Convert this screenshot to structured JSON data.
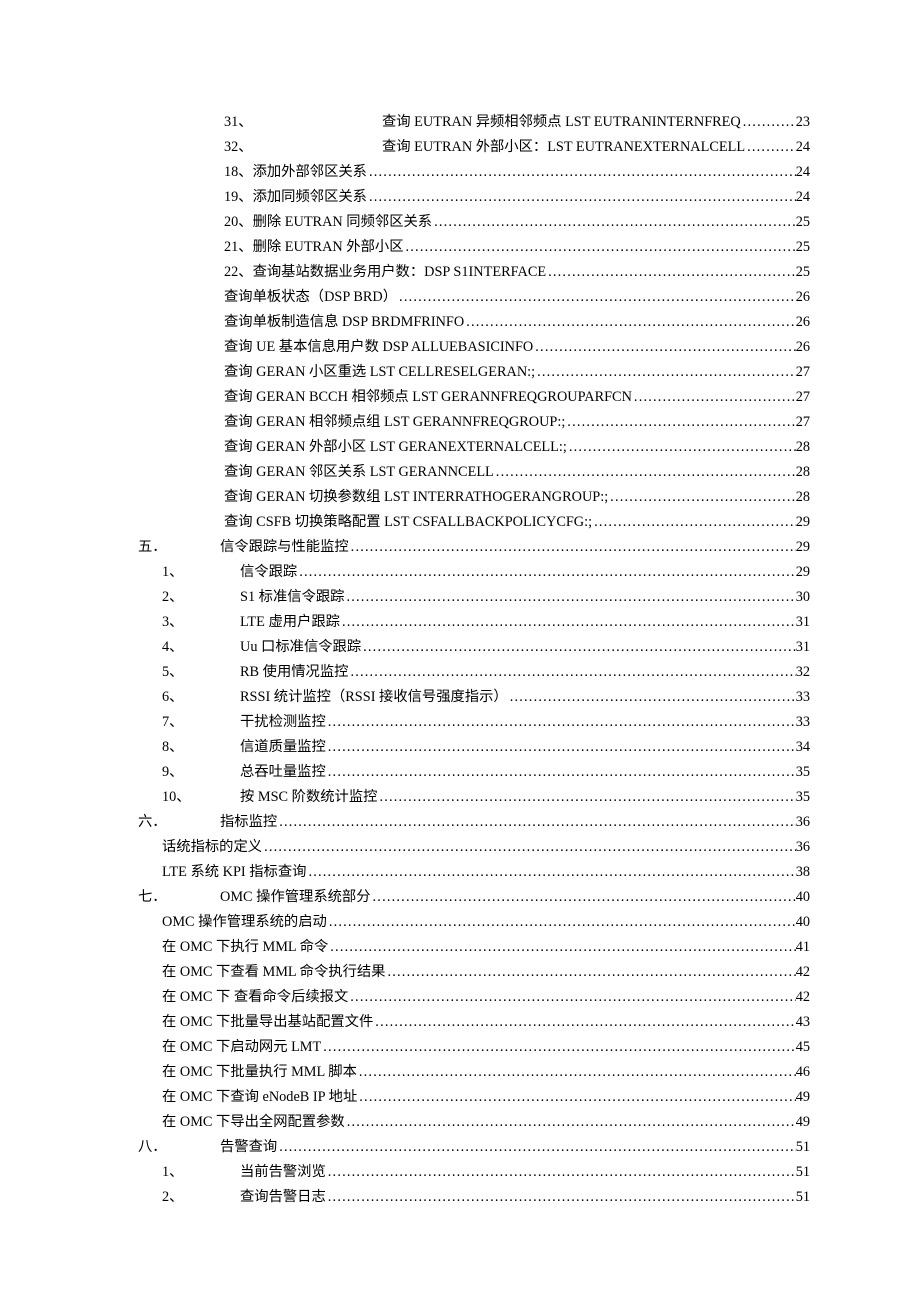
{
  "rows": [
    {
      "style": "deepnum",
      "num": "31、",
      "label": "查询 EUTRAN 异频相邻频点 LST EUTRANINTERNFREQ",
      "page": "23"
    },
    {
      "style": "deepnum",
      "num": "32、",
      "label": "查询 EUTRAN 外部小区：LST EUTRANEXTERNALCELL",
      "page": "24"
    },
    {
      "style": "deepplain",
      "num": "",
      "label": "18、添加外部邻区关系",
      "page": "24"
    },
    {
      "style": "deepplain",
      "num": "",
      "label": "19、添加同频邻区关系",
      "page": "24"
    },
    {
      "style": "deepplain",
      "num": "",
      "label": "20、删除 EUTRAN 同频邻区关系",
      "page": "25"
    },
    {
      "style": "deepplain",
      "num": "",
      "label": "21、删除 EUTRAN 外部小区",
      "page": "25"
    },
    {
      "style": "deepplain",
      "num": "",
      "label": "22、查询基站数据业务用户数：DSP S1INTERFACE",
      "page": "25"
    },
    {
      "style": "deepplain",
      "num": "",
      "label": "查询单板状态（DSP BRD）",
      "page": "26"
    },
    {
      "style": "deepplain",
      "num": "",
      "label": "查询单板制造信息 DSP BRDMFRINFO",
      "page": "26"
    },
    {
      "style": "deepplain",
      "num": "",
      "label": "查询 UE 基本信息用户数    DSP ALLUEBASICINFO",
      "page": "26"
    },
    {
      "style": "deepplain",
      "num": "",
      "label": "查询 GERAN 小区重选 LST CELLRESELGERAN:;",
      "page": "27"
    },
    {
      "style": "deepplain",
      "num": "",
      "label": "查询 GERAN BCCH 相邻频点  LST GERANNFREQGROUPARFCN",
      "page": "27"
    },
    {
      "style": "deepplain",
      "num": "",
      "label": "查询 GERAN 相邻频点组 LST GERANNFREQGROUP:;",
      "page": "27"
    },
    {
      "style": "deepplain",
      "num": "",
      "label": "查询 GERAN 外部小区 LST GERANEXTERNALCELL:;",
      "page": "28"
    },
    {
      "style": "deepplain",
      "num": "",
      "label": "查询 GERAN 邻区关系 LST GERANNCELL",
      "page": "28"
    },
    {
      "style": "deepplain",
      "num": "",
      "label": "查询 GERAN 切换参数组 LST INTERRATHOGERANGROUP:;",
      "page": "28"
    },
    {
      "style": "deepplain",
      "num": "",
      "label": "查询 CSFB 切换策略配置 LST CSFALLBACKPOLICYCFG:;",
      "page": "29"
    },
    {
      "style": "major",
      "majornum": "五．",
      "label": "信令跟踪与性能监控",
      "page": "29"
    },
    {
      "style": "itemnum",
      "num": "1、",
      "label": "信令跟踪",
      "page": "29"
    },
    {
      "style": "itemnum",
      "num": "2、",
      "label": "S1 标准信令跟踪",
      "page": "30"
    },
    {
      "style": "itemnum",
      "num": "3、",
      "label": "LTE 虚用户跟踪",
      "page": "31"
    },
    {
      "style": "itemnum",
      "num": "4、",
      "label": "Uu 口标准信令跟踪",
      "page": "31"
    },
    {
      "style": "itemnum",
      "num": "5、",
      "label": "RB 使用情况监控",
      "page": "32"
    },
    {
      "style": "itemnum",
      "num": "6、",
      "label": "RSSI 统计监控（RSSI  接收信号强度指示）",
      "page": "33"
    },
    {
      "style": "itemnum",
      "num": "7、",
      "label": "干扰检测监控",
      "page": "33"
    },
    {
      "style": "itemnum",
      "num": "8、",
      "label": "信道质量监控",
      "page": "34"
    },
    {
      "style": "itemnum",
      "num": "9、",
      "label": "总吞吐量监控",
      "page": "35"
    },
    {
      "style": "itemnum",
      "num": "10、",
      "label": "按 MSC 阶数统计监控",
      "page": "35"
    },
    {
      "style": "major",
      "majornum": "六．",
      "label": "指标监控",
      "page": "36"
    },
    {
      "style": "sub",
      "num": "",
      "label": "话统指标的定义",
      "page": "36"
    },
    {
      "style": "sub",
      "num": "",
      "label": "LTE 系统 KPI 指标查询",
      "page": "38"
    },
    {
      "style": "major",
      "majornum": "七．",
      "label": "OMC 操作管理系统部分",
      "page": "40"
    },
    {
      "style": "sub",
      "num": "",
      "label": "OMC 操作管理系统的启动",
      "page": "40"
    },
    {
      "style": "sub",
      "num": "",
      "label": "在 OMC 下执行 MML 命令",
      "page": "41"
    },
    {
      "style": "sub",
      "num": "",
      "label": "在 OMC 下查看 MML  命令执行结果",
      "page": "42"
    },
    {
      "style": "sub",
      "num": "",
      "label": "在 OMC 下 查看命令后续报文",
      "page": "42"
    },
    {
      "style": "sub",
      "num": "",
      "label": "在 OMC 下批量导出基站配置文件",
      "page": "43"
    },
    {
      "style": "sub",
      "num": "",
      "label": "在 OMC 下启动网元 LMT",
      "page": "45"
    },
    {
      "style": "sub",
      "num": "",
      "label": "在 OMC 下批量执行 MML 脚本",
      "page": "46"
    },
    {
      "style": "sub",
      "num": "",
      "label": "在 OMC 下查询 eNodeB IP 地址",
      "page": "49"
    },
    {
      "style": "sub",
      "num": "",
      "label": "在 OMC 下导出全网配置参数",
      "page": "49"
    },
    {
      "style": "major",
      "majornum": "八．",
      "label": "告警查询",
      "page": "51"
    },
    {
      "style": "itemnum",
      "num": "1、",
      "label": "当前告警浏览",
      "page": "51"
    },
    {
      "style": "itemnum",
      "num": "2、",
      "label": "查询告警日志",
      "page": "51"
    }
  ]
}
